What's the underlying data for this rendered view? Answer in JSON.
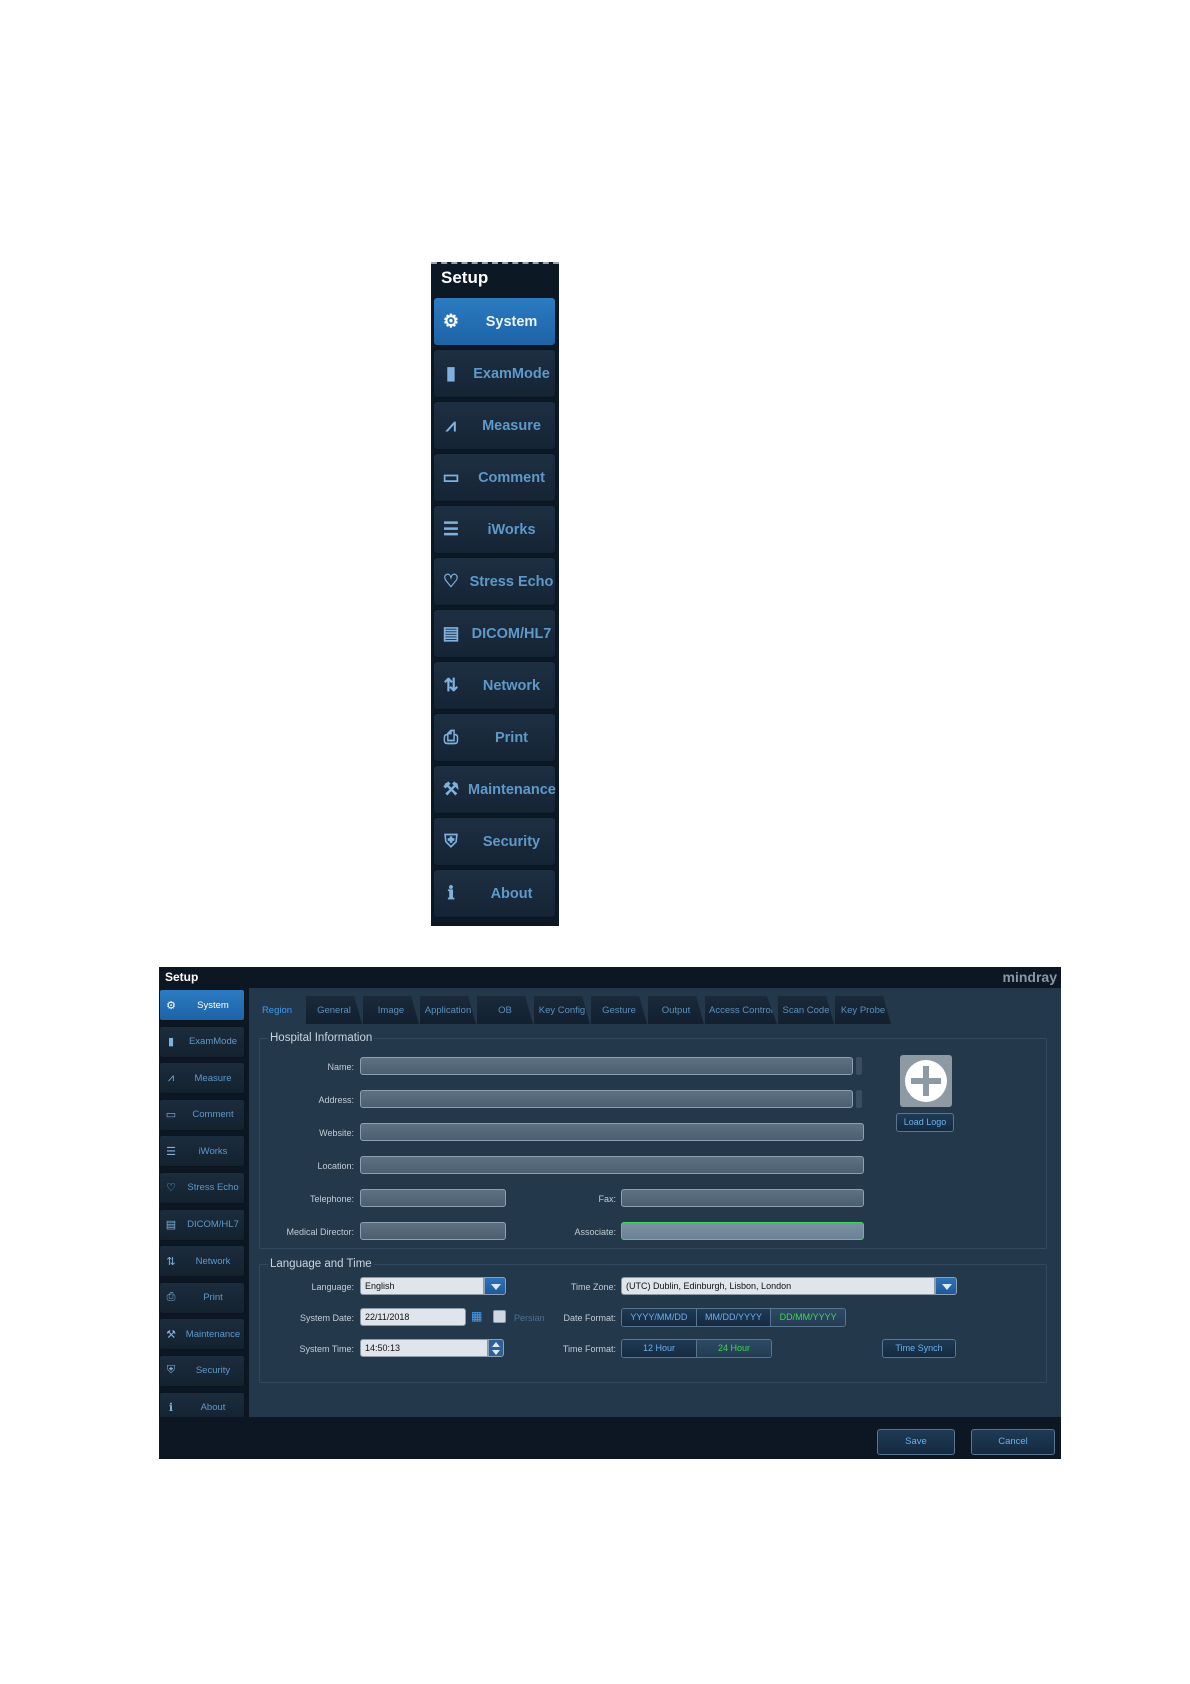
{
  "menu": {
    "title": "Setup",
    "items": [
      {
        "label": "System",
        "icon": "gear-icon",
        "glyph": "⚙",
        "active": true
      },
      {
        "label": "ExamMode",
        "icon": "probe-icon",
        "glyph": "▮",
        "active": false
      },
      {
        "label": "Measure",
        "icon": "caliper-icon",
        "glyph": "⩘",
        "active": false
      },
      {
        "label": "Comment",
        "icon": "comment-icon",
        "glyph": "▭",
        "active": false
      },
      {
        "label": "iWorks",
        "icon": "list-icon",
        "glyph": "☰",
        "active": false
      },
      {
        "label": "Stress Echo",
        "icon": "heart-icon",
        "glyph": "♡",
        "active": false
      },
      {
        "label": "DICOM/HL7",
        "icon": "document-icon",
        "glyph": "▤",
        "active": false
      },
      {
        "label": "Network",
        "icon": "network-icon",
        "glyph": "⇅",
        "active": false
      },
      {
        "label": "Print",
        "icon": "printer-icon",
        "glyph": "⎙",
        "active": false
      },
      {
        "label": "Maintenance",
        "icon": "tools-icon",
        "glyph": "⚒",
        "active": false
      },
      {
        "label": "Security",
        "icon": "shield-icon",
        "glyph": "⛨",
        "active": false
      },
      {
        "label": "About",
        "icon": "info-icon",
        "glyph": "ℹ",
        "active": false
      }
    ]
  },
  "window": {
    "title": "Setup",
    "brand": "mindray",
    "tabs": [
      "Region",
      "General",
      "Image",
      "Application",
      "OB",
      "Key Config",
      "Gesture",
      "Output",
      "Access Control",
      "Scan Code",
      "Key Probe"
    ],
    "active_tab": "Region"
  },
  "hospital": {
    "legend": "Hospital Information",
    "name_label": "Name:",
    "name_value": "",
    "address_label": "Address:",
    "address_value": "",
    "website_label": "Website:",
    "website_value": "",
    "location_label": "Location:",
    "location_value": "",
    "telephone_label": "Telephone:",
    "telephone_value": "",
    "fax_label": "Fax:",
    "fax_value": "",
    "director_label": "Medical Director:",
    "director_value": "",
    "associate_label": "Associate:",
    "associate_value": "",
    "load_logo": "Load Logo"
  },
  "langtime": {
    "legend": "Language and Time",
    "language_label": "Language:",
    "language_value": "English",
    "timezone_label": "Time Zone:",
    "timezone_value": "(UTC) Dublin, Edinburgh, Lisbon, London",
    "date_label": "System Date:",
    "date_value": "22/11/2018",
    "persian_label": "Persian",
    "dateformat_label": "Date Format:",
    "date_formats": [
      "YYYY/MM/DD",
      "MM/DD/YYYY",
      "DD/MM/YYYY"
    ],
    "date_format_selected": "DD/MM/YYYY",
    "time_label": "System Time:",
    "time_value": "14:50:13",
    "timeformat_label": "Time Format:",
    "time_formats": [
      "12 Hour",
      "24 Hour"
    ],
    "time_format_selected": "24 Hour",
    "time_synch": "Time Synch"
  },
  "footer": {
    "save": "Save",
    "cancel": "Cancel"
  },
  "colors": {
    "accent": "#2c7bc2",
    "selected_text": "#3fd84c",
    "panel": "#24384c",
    "background": "#0d1723"
  }
}
